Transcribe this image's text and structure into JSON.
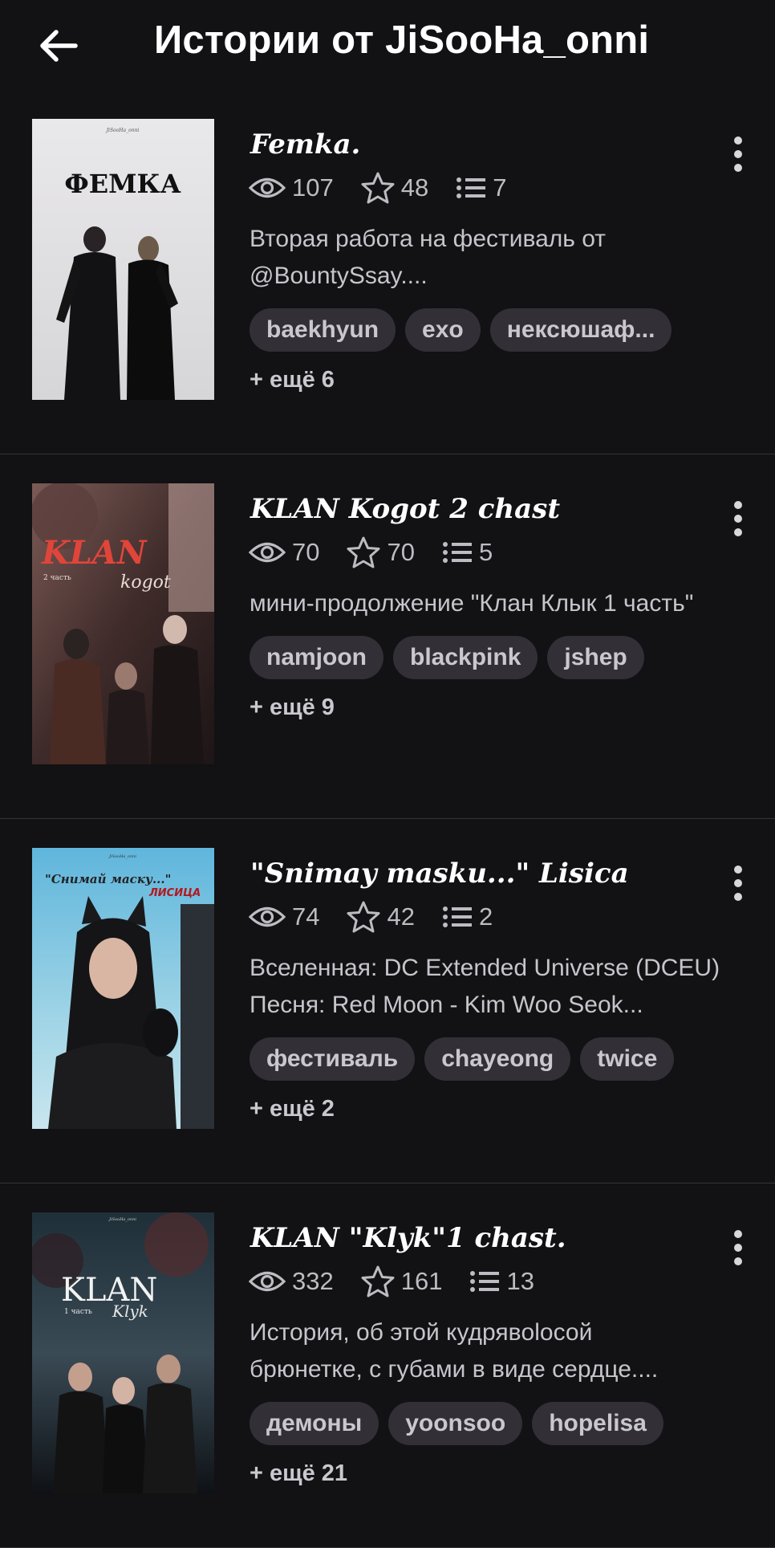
{
  "header": {
    "back_icon": "arrow-left-icon",
    "title": "Истории от JiSooHa_onni"
  },
  "icons": {
    "views": "eye-icon",
    "votes": "star-icon",
    "parts": "list-icon",
    "menu": "more-vertical-icon"
  },
  "stories": [
    {
      "title": "Femka.",
      "views": "107",
      "votes": "48",
      "parts": "7",
      "description": [
        "Вторая работа на фестиваль от",
        "@BountySsay...."
      ],
      "tags": [
        "baekhyun",
        "exo",
        "нексюшаф..."
      ],
      "more_tags": "+ ещё 6",
      "cover": {
        "text": "ФЕМКА",
        "author": "JiSooHa_onni"
      }
    },
    {
      "title": "KLAN Kogot 2 chast",
      "views": "70",
      "votes": "70",
      "parts": "5",
      "description": [
        "мини-продолжение \"Клан Клык 1 часть\""
      ],
      "tags": [
        "namjoon",
        "blackpink",
        "jshep"
      ],
      "more_tags": "+ ещё 9",
      "cover": {
        "text": "KLAN",
        "subtitle": "kogot",
        "part": "2 часть"
      }
    },
    {
      "title": "\"Snimay masku...\" Lisica",
      "views": "74",
      "votes": "42",
      "parts": "2",
      "description": [
        "Вселенная: DC Extended Universe (DCEU)",
        "Песня: Red Moon - Kim Woo Seok..."
      ],
      "tags": [
        "фестиваль",
        "chayeong",
        "twice"
      ],
      "more_tags": "+ ещё 2",
      "cover": {
        "text": "\"Снимай маску...\"",
        "subtitle": "ЛИСИЦА",
        "author": "JiSooHa_onni"
      }
    },
    {
      "title": "KLAN \"Klyk\"1 chast.",
      "views": "332",
      "votes": "161",
      "parts": "13",
      "description": [
        "История, об этой кудрявolосой",
        "брюнетке, с губами в виде сердце...."
      ],
      "tags": [
        "демоны",
        "yoonsoo",
        "hopelisa"
      ],
      "more_tags": "+ ещё 21",
      "cover": {
        "text": "KLAN",
        "subtitle": "Klyk",
        "part": "1 часть",
        "author": "JiSooHa_onni"
      }
    }
  ]
}
